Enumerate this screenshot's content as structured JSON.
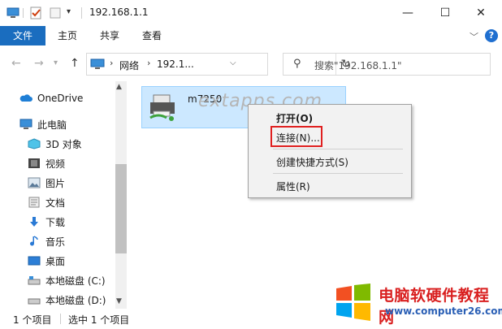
{
  "window": {
    "title": "192.168.1.1",
    "controls": {
      "minimize": "—",
      "maximize": "☐",
      "close": "✕"
    }
  },
  "ribbon": {
    "tabs": [
      "文件",
      "主页",
      "共享",
      "查看"
    ],
    "expand_icon": "chevron-down",
    "help_label": "?"
  },
  "address_bar": {
    "crumbs": [
      "网络",
      "192.1..."
    ],
    "search_placeholder": "搜索\"192.168.1.1\""
  },
  "sidebar": {
    "items": [
      {
        "label": "OneDrive",
        "icon": "cloud-icon"
      },
      {
        "label": "此电脑",
        "icon": "computer-icon"
      },
      {
        "label": "3D 对象",
        "icon": "cube-icon"
      },
      {
        "label": "视频",
        "icon": "video-icon"
      },
      {
        "label": "图片",
        "icon": "picture-icon"
      },
      {
        "label": "文档",
        "icon": "document-icon"
      },
      {
        "label": "下载",
        "icon": "download-icon"
      },
      {
        "label": "音乐",
        "icon": "music-icon"
      },
      {
        "label": "桌面",
        "icon": "desktop-icon"
      },
      {
        "label": "本地磁盘 (C:)",
        "icon": "drive-icon"
      },
      {
        "label": "本地磁盘 (D:)",
        "icon": "drive-icon"
      }
    ]
  },
  "main": {
    "items": [
      {
        "name": "m7250",
        "icon": "printer-icon"
      }
    ]
  },
  "watermark": "extapps.com",
  "context_menu": {
    "items": [
      "打开(O)",
      "连接(N)...",
      "创建快捷方式(S)",
      "属性(R)"
    ]
  },
  "status_bar": {
    "count": "1 个项目",
    "selected": "选中 1 个项目"
  },
  "branding": {
    "name": "电脑软硬件教程网",
    "url": "www.computer26.com"
  },
  "colors": {
    "accent": "#1a6dbf",
    "selection": "#cce8ff",
    "highlight_box": "#e02020"
  }
}
